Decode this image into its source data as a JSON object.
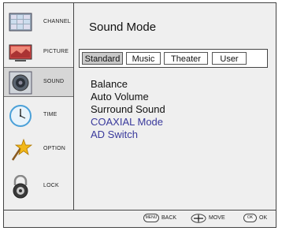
{
  "sidebar": {
    "items": [
      {
        "label": "CHANNEL",
        "icon": "tv-grid-icon",
        "selected": false
      },
      {
        "label": "PICTURE",
        "icon": "picture-icon",
        "selected": false
      },
      {
        "label": "SOUND",
        "icon": "speaker-icon",
        "selected": true
      },
      {
        "label": "TIME",
        "icon": "clock-icon",
        "selected": false
      },
      {
        "label": "OPTION",
        "icon": "star-wand-icon",
        "selected": false
      },
      {
        "label": "LOCK",
        "icon": "padlock-icon",
        "selected": false
      }
    ]
  },
  "main": {
    "title": "Sound Mode",
    "tabs": [
      {
        "label": "Standard",
        "active": true
      },
      {
        "label": "Music",
        "active": false
      },
      {
        "label": "Theater",
        "active": false
      },
      {
        "label": "User",
        "active": false
      }
    ],
    "menu": [
      {
        "label": "Balance",
        "highlight": false
      },
      {
        "label": "Auto Volume",
        "highlight": false
      },
      {
        "label": "Surround Sound",
        "highlight": false
      },
      {
        "label": "COAXIAL Mode",
        "highlight": true
      },
      {
        "label": "AD Switch",
        "highlight": true
      }
    ]
  },
  "footer": {
    "menu_button": "MENU",
    "back": "BACK",
    "move": "MOVE",
    "ok_button": "OK",
    "ok": "OK"
  },
  "colors": {
    "highlight_text": "#3a3a9c",
    "active_tab": "#c9c9c9",
    "selected_sidebar": "#d6d6d6"
  }
}
